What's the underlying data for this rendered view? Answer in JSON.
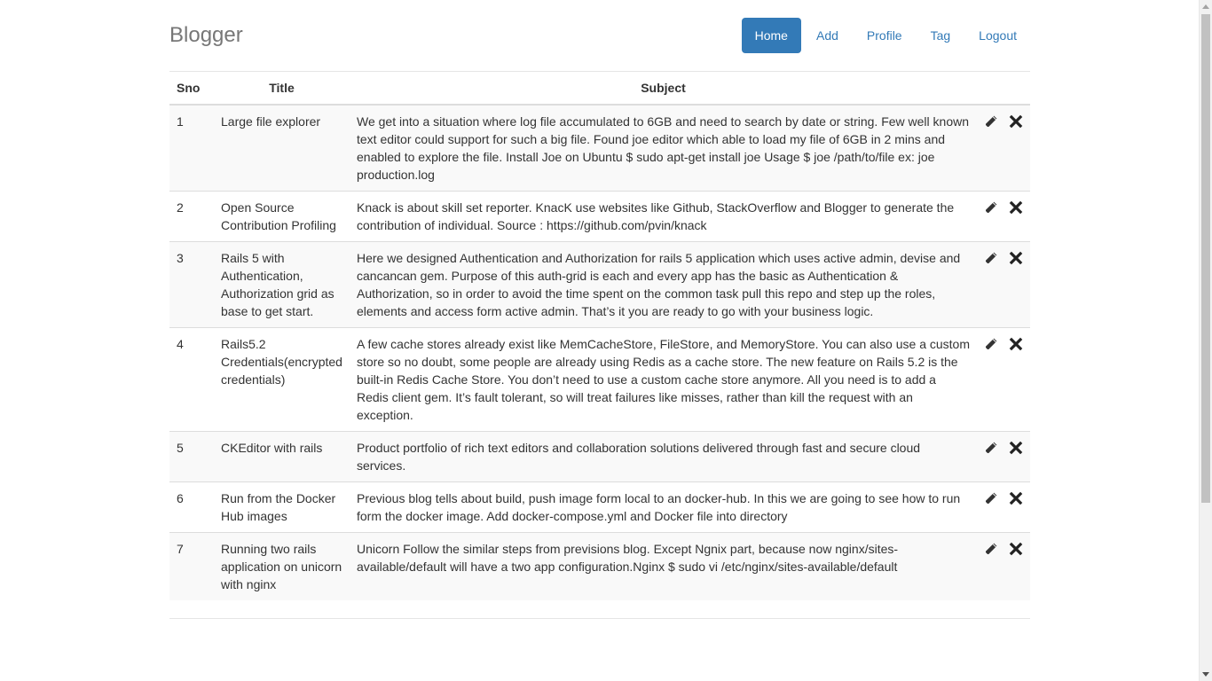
{
  "brand": "Blogger",
  "nav": {
    "items": [
      {
        "label": "Home",
        "active": true
      },
      {
        "label": "Add",
        "active": false
      },
      {
        "label": "Profile",
        "active": false
      },
      {
        "label": "Tag",
        "active": false
      },
      {
        "label": "Logout",
        "active": false
      }
    ]
  },
  "table": {
    "headers": {
      "sno": "Sno",
      "title": "Title",
      "subject": "Subject"
    },
    "rows": [
      {
        "sno": "1",
        "title": "Large file explorer",
        "subject": "We get into a situation where log file accumulated to 6GB and need to search by date or string. Few well known text editor could support for such a big file. Found joe editor which able to load my file of 6GB in 2 mins and enabled to explore the file. Install Joe on Ubuntu $ sudo apt-get install joe Usage $ joe /path/to/file ex: joe production.log"
      },
      {
        "sno": "2",
        "title": "Open Source Contribution Profiling",
        "subject": "Knack is about skill set reporter. KnacK use websites like Github, StackOverflow and Blogger to generate the contribution of individual. Source : https://github.com/pvin/knack"
      },
      {
        "sno": "3",
        "title": "Rails 5 with Authentication, Authorization grid as base to get start.",
        "subject": "Here we designed Authentication and Authorization for rails 5 application which uses active admin, devise and cancancan gem. Purpose of this auth-grid is each and every app has the basic as Authentication & Authorization, so in order to avoid the time spent on the common task pull this repo and step up the roles, elements and access form active admin. That’s it you are ready to go with your business logic."
      },
      {
        "sno": "4",
        "title": "Rails5.2 Credentials(encrypted credentials)",
        "subject": "A few cache stores already exist like MemCacheStore, FileStore, and MemoryStore. You can also use a custom store so no doubt, some people are already using Redis as a cache store. The new feature on Rails 5.2 is the built-in Redis Cache Store. You don’t need to use a custom cache store anymore. All you need is to add a Redis client gem. It’s fault tolerant, so will treat failures like misses, rather than kill the request with an exception."
      },
      {
        "sno": "5",
        "title": "CKEditor with rails",
        "subject": "Product portfolio of rich text editors and collaboration solutions delivered through fast and secure cloud services."
      },
      {
        "sno": "6",
        "title": "Run from the Docker Hub images",
        "subject": "Previous blog tells about build, push image form local to an docker-hub. In this we are going to see how to run form the docker image. Add docker-compose.yml and Docker file into directory"
      },
      {
        "sno": "7",
        "title": "Running two rails application on unicorn with nginx",
        "subject": "Unicorn Follow the similar steps from previsions blog. Except Ngnix part, because now nginx/sites-available/default will have a two app configuration.Nginx $ sudo vi /etc/nginx/sites-available/default"
      }
    ],
    "row_icons": {
      "edit": "pencil-icon",
      "delete": "remove-icon"
    }
  },
  "colors": {
    "primary": "#337ab7",
    "brand_text": "#777777",
    "stripe": "#f9f9f9",
    "border": "#dddddd"
  }
}
